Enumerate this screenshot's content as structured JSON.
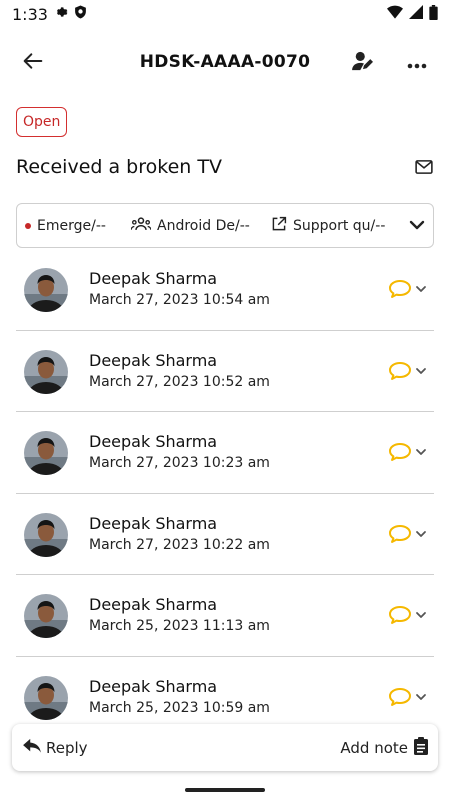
{
  "status_bar": {
    "time": "1:33",
    "icons": [
      "gear-icon",
      "shield-icon",
      "wifi-icon",
      "signal-icon",
      "battery-icon"
    ]
  },
  "header": {
    "ticket_id": "HDSK-AAAA-0070",
    "icons": [
      "back-arrow-icon",
      "assign-agent-icon",
      "more-horizontal-icon"
    ]
  },
  "ticket": {
    "status": "Open",
    "status_color": "#d32f2f",
    "subject": "Received a broken TV",
    "priority": "Emerge/--",
    "team": "Android De/--",
    "channel": "Support qu/--"
  },
  "conversations": [
    {
      "author": "Deepak Sharma",
      "timestamp": "March 27, 2023 10:54 am"
    },
    {
      "author": "Deepak Sharma",
      "timestamp": "March 27, 2023 10:52 am"
    },
    {
      "author": "Deepak Sharma",
      "timestamp": "March 27, 2023 10:23 am"
    },
    {
      "author": "Deepak Sharma",
      "timestamp": "March 27, 2023 10:22 am"
    },
    {
      "author": "Deepak Sharma",
      "timestamp": "March 25, 2023 11:13 am"
    },
    {
      "author": "Deepak Sharma",
      "timestamp": "March 25, 2023 10:59 am"
    }
  ],
  "conversation_icon_color": "#f5b800",
  "actions": {
    "reply": "Reply",
    "add_note": "Add note"
  }
}
